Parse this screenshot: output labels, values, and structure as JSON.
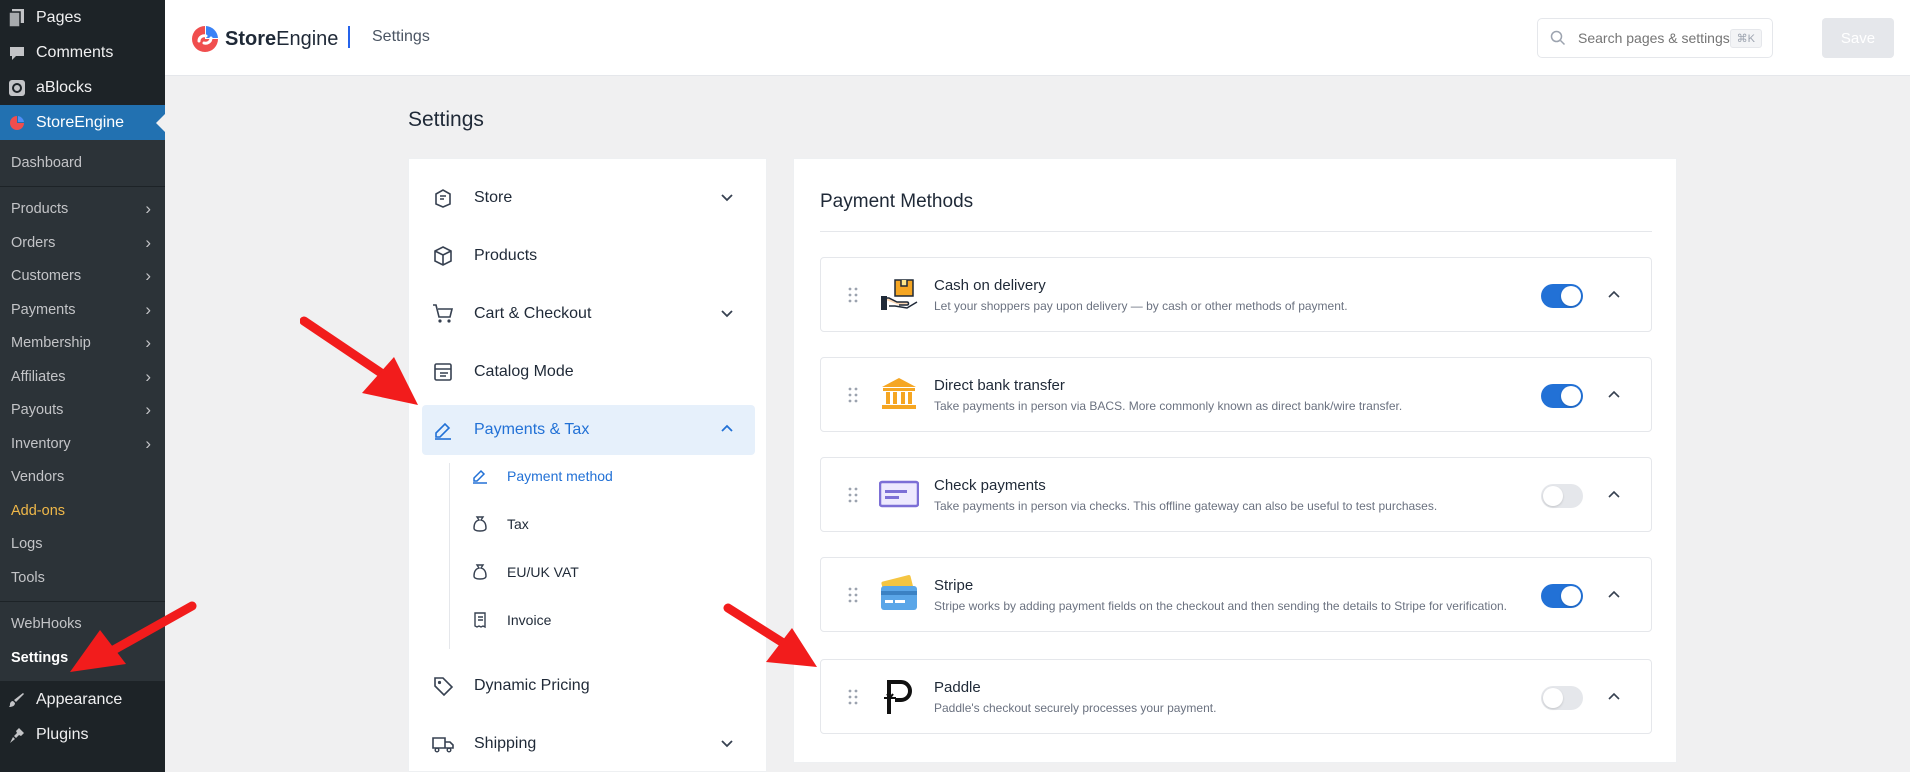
{
  "wp_sidebar": {
    "top_items": [
      {
        "label": "Pages",
        "icon": "pages-icon"
      },
      {
        "label": "Comments",
        "icon": "comment-icon"
      },
      {
        "label": "aBlocks",
        "icon": "ablocks-icon"
      },
      {
        "label": "StoreEngine",
        "icon": "storeengine-icon"
      }
    ],
    "sub_items": [
      {
        "label": "Dashboard",
        "chevron": false
      },
      {
        "label": "Products",
        "chevron": true
      },
      {
        "label": "Orders",
        "chevron": true
      },
      {
        "label": "Customers",
        "chevron": true
      },
      {
        "label": "Payments",
        "chevron": true
      },
      {
        "label": "Membership",
        "chevron": true
      },
      {
        "label": "Affiliates",
        "chevron": true
      },
      {
        "label": "Payouts",
        "chevron": true
      },
      {
        "label": "Inventory",
        "chevron": true
      },
      {
        "label": "Vendors",
        "chevron": false
      },
      {
        "label": "Add-ons",
        "chevron": false
      },
      {
        "label": "Logs",
        "chevron": false
      },
      {
        "label": "Tools",
        "chevron": false
      },
      {
        "label": "WebHooks",
        "chevron": false
      },
      {
        "label": "Settings",
        "chevron": false
      }
    ],
    "bottom_items": [
      {
        "label": "Appearance",
        "icon": "appearance-icon"
      },
      {
        "label": "Plugins",
        "icon": "plugins-icon"
      }
    ],
    "chevron_glyph": "›"
  },
  "header": {
    "logo_bold": "Store",
    "logo_rest": "Engine",
    "breadcrumb": "Settings",
    "search_placeholder": "Search pages & settings...",
    "search_shortcut": "⌘K",
    "save_label": "Save"
  },
  "page_title": "Settings",
  "settings_nav": {
    "items": [
      {
        "label": "Store",
        "icon": "store-icon",
        "expandable": true
      },
      {
        "label": "Products",
        "icon": "box-icon",
        "expandable": false
      },
      {
        "label": "Cart & Checkout",
        "icon": "cart-icon",
        "expandable": true
      },
      {
        "label": "Catalog Mode",
        "icon": "catalog-icon",
        "expandable": false
      },
      {
        "label": "Payments & Tax",
        "icon": "payments-tax-icon",
        "expandable": true,
        "active": true
      },
      {
        "label": "Dynamic Pricing",
        "icon": "tag-icon",
        "expandable": false
      },
      {
        "label": "Shipping",
        "icon": "truck-icon",
        "expandable": true
      }
    ],
    "sub_items": [
      {
        "label": "Payment method",
        "icon": "payment-method-icon",
        "current": true
      },
      {
        "label": "Tax",
        "icon": "money-bag-icon"
      },
      {
        "label": "EU/UK VAT",
        "icon": "money-bag-icon"
      },
      {
        "label": "Invoice",
        "icon": "invoice-icon"
      }
    ]
  },
  "payment_methods": {
    "title": "Payment Methods",
    "methods": [
      {
        "name": "Cash on delivery",
        "description": "Let your shoppers pay upon delivery — by cash or other methods of payment.",
        "enabled": true,
        "icon": "cash-delivery-icon"
      },
      {
        "name": "Direct bank transfer",
        "description": "Take payments in person via BACS. More commonly known as direct bank/wire transfer.",
        "enabled": true,
        "icon": "bank-icon"
      },
      {
        "name": "Check payments",
        "description": "Take payments in person via checks. This offline gateway can also be useful to test purchases.",
        "enabled": false,
        "icon": "check-icon"
      },
      {
        "name": "Stripe",
        "description": "Stripe works by adding payment fields on the checkout and then sending the details to Stripe for verification.",
        "enabled": true,
        "icon": "card-icon"
      },
      {
        "name": "Paddle",
        "description": "Paddle's checkout securely processes your payment.",
        "enabled": false,
        "icon": "paddle-icon"
      }
    ]
  },
  "colors": {
    "accent": "#2271d6",
    "wp_sidebar_bg": "#1d2327",
    "wp_active": "#2271b1",
    "arrow_red": "#f21c1c"
  }
}
